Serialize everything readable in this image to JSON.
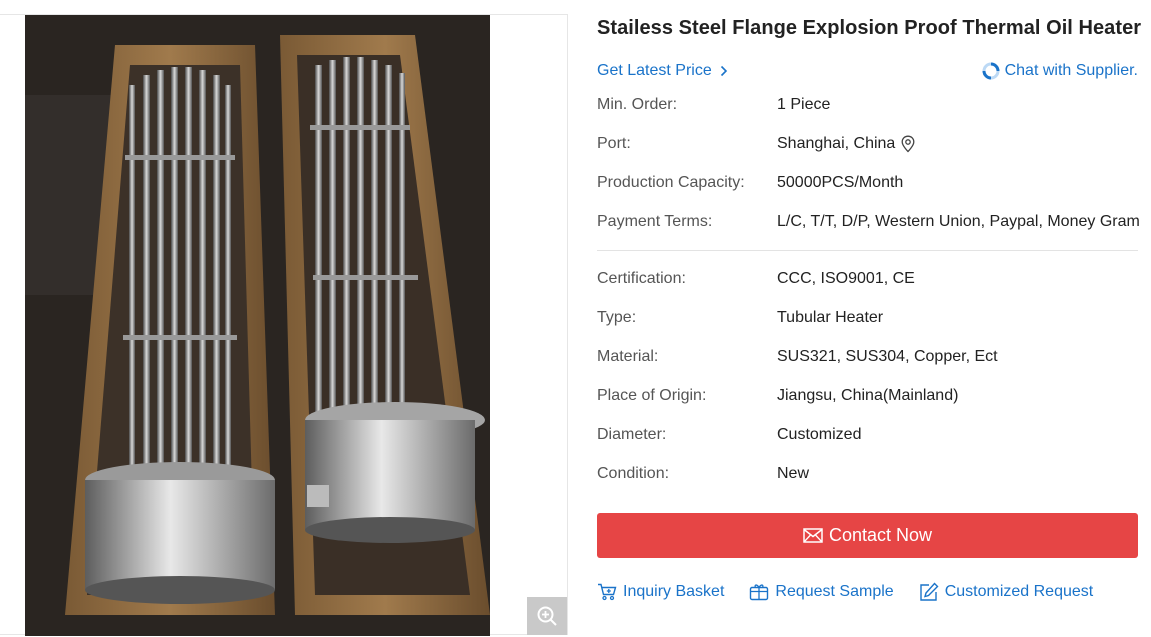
{
  "product": {
    "title": "Stailess Steel Flange Explosion Proof Thermal Oil Heater",
    "get_latest_price": "Get Latest Price",
    "chat_with_supplier": "Chat with Supplier.",
    "trade_specs": [
      {
        "key": "Min. Order:",
        "value": "1 Piece"
      },
      {
        "key": "Port:",
        "value": "Shanghai, China"
      },
      {
        "key": "Production Capacity:",
        "value": "50000PCS/Month"
      },
      {
        "key": "Payment Terms:",
        "value": "L/C, T/T, D/P, Western Union, Paypal, Money Gram"
      }
    ],
    "product_specs": [
      {
        "key": "Certification:",
        "value": "CCC, ISO9001, CE"
      },
      {
        "key": "Type:",
        "value": "Tubular Heater"
      },
      {
        "key": "Material:",
        "value": "SUS321, SUS304, Copper, Ect"
      },
      {
        "key": "Place of Origin:",
        "value": "Jiangsu, China(Mainland)"
      },
      {
        "key": "Diameter:",
        "value": "Customized"
      },
      {
        "key": "Condition:",
        "value": "New"
      }
    ],
    "contact_label": "Contact Now",
    "actions": {
      "inquiry_basket": "Inquiry Basket",
      "request_sample": "Request Sample",
      "customized_request": "Customized Request"
    }
  },
  "icons": {
    "zoom": "zoom-in-icon",
    "location": "location-pin-icon",
    "chat": "chat-loading-icon",
    "mail": "mail-icon",
    "cart": "cart-icon",
    "sample": "gift-box-icon",
    "edit": "edit-icon"
  },
  "colors": {
    "link": "#1a73c9",
    "contact_button": "#e64545",
    "zoom_button": "#c9c9c9"
  }
}
